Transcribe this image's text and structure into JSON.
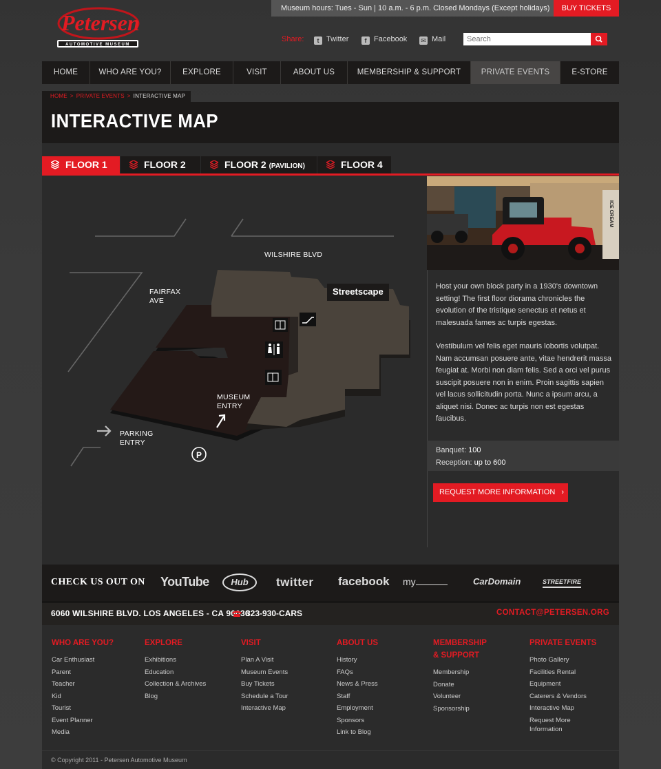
{
  "header": {
    "logo_text": "Petersen",
    "logo_subtext": "AUTOMOTIVE MUSEUM",
    "hours": "Museum hours: Tues - Sun | 10 a.m. - 6 p.m. Closed Mondays (Except holidays)",
    "buy_tickets": "BUY TICKETS",
    "share_label": "Share:",
    "share_links": [
      {
        "label": "Twitter",
        "icon": "twitter-icon"
      },
      {
        "label": "Facebook",
        "icon": "facebook-icon"
      },
      {
        "label": "Mail",
        "icon": "mail-icon"
      }
    ],
    "search_placeholder": "Search"
  },
  "nav": {
    "items": [
      {
        "label": "HOME"
      },
      {
        "label": "WHO ARE YOU?"
      },
      {
        "label": "EXPLORE"
      },
      {
        "label": "VISIT"
      },
      {
        "label": "ABOUT US"
      },
      {
        "label": "MEMBERSHIP & SUPPORT"
      },
      {
        "label": "PRIVATE EVENTS",
        "active": true
      },
      {
        "label": "E-STORE"
      }
    ]
  },
  "breadcrumb": {
    "items": [
      "HOME",
      "PRIVATE EVENTS",
      "INTERACTIVE MAP"
    ]
  },
  "page_title": "INTERACTIVE MAP",
  "floor_tabs": [
    {
      "label": "FLOOR 1",
      "active": true
    },
    {
      "label": "FLOOR 2"
    },
    {
      "label": "FLOOR 2",
      "suffix": "(PAVILION)"
    },
    {
      "label": "FLOOR 4"
    }
  ],
  "map": {
    "street_label": "WILSHIRE BLVD",
    "fairfax_label_1": "FAIRFAX",
    "fairfax_label_2": "AVE",
    "museum_entry_1": "MUSEUM",
    "museum_entry_2": "ENTRY",
    "parking_entry_1": "PARKING",
    "parking_entry_2": "ENTRY",
    "callout": "Streetscape",
    "parking_symbol": "P"
  },
  "panel": {
    "paragraph_1": "Host your own block party in a 1930's downtown setting! The first floor diorama chronicles the evolution of the tristique senectus et netus et malesuada fames ac turpis egestas.",
    "paragraph_2": "Vestibulum vel felis eget mauris lobortis volutpat. Nam accumsan posuere ante, vitae hendrerit massa feugiat at. Morbi non diam felis. Sed a orci vel purus suscipit posuere non in enim. Proin sagittis sapien vel lacus sollicitudin porta. Nunc a ipsum arcu, a aliquet nisi. Donec ac turpis non est egestas faucibus.",
    "banquet_label": "Banquet:",
    "banquet_value": "100",
    "reception_label": "Reception:",
    "reception_value": "up to 600",
    "request_button": "REQUEST MORE INFORMATION",
    "photo_sign_text": "ICE CREAM"
  },
  "social": {
    "label": "CHECK US OUT ON",
    "networks": [
      "YouTube",
      "Hub",
      "twitter",
      "facebook",
      "my",
      "CarDomain",
      "STREETFIRE"
    ]
  },
  "contact": {
    "address": "6060 WILSHIRE BLVD. LOS ANGELES - CA 90036",
    "phone": "323-930-CARS",
    "email": "CONTACT@PETERSEN.ORG"
  },
  "footer": {
    "columns": [
      {
        "heading": "WHO ARE YOU?",
        "links": [
          "Car Enthusiast",
          "Parent",
          "Teacher",
          "Kid",
          "Tourist",
          "Event Planner",
          "Media"
        ]
      },
      {
        "heading": "EXPLORE",
        "links": [
          "Exhibitions",
          "Education",
          "Collection & Archives",
          "Blog"
        ]
      },
      {
        "heading": "VISIT",
        "links": [
          "Plan A Visit",
          "Museum Events",
          "Buy Tickets",
          "Schedule a Tour",
          "Interactive Map"
        ]
      },
      {
        "heading": "ABOUT US",
        "links": [
          "History",
          "FAQs",
          "News & Press",
          "Staff",
          "Employment",
          "Sponsors",
          "Link to Blog"
        ]
      },
      {
        "heading": "MEMBERSHIP",
        "heading_2": "& SUPPORT",
        "links": [
          "Membership",
          "Donate",
          "Volunteer",
          "Sponsorship"
        ]
      },
      {
        "heading": "PRIVATE EVENTS",
        "links": [
          "Photo Gallery",
          "Facilities Rental",
          "Equipment",
          "Caterers & Vendors",
          "Interactive Map",
          "Request More",
          "Information"
        ]
      }
    ],
    "copyright": "© Copyright 2011 - Petersen Automotive Museum"
  },
  "colors": {
    "accent": "#e31b23",
    "dark": "#1c1a19",
    "panel": "#2b2b2b"
  }
}
